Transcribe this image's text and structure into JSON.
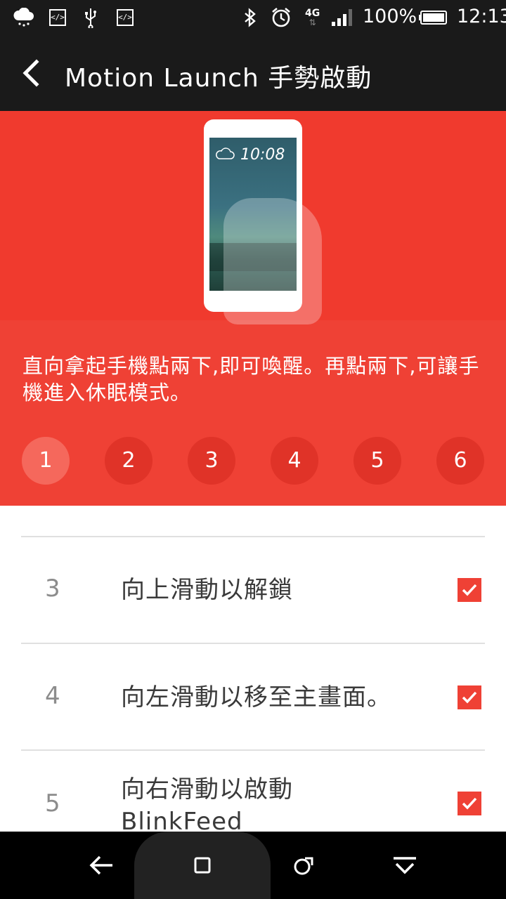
{
  "status_bar": {
    "battery_percent": "100%",
    "time": "12:13",
    "network_type": "4G",
    "icons": [
      "weather-cloud-rain-icon",
      "code-icon",
      "usb-icon",
      "code-icon",
      "bluetooth-icon",
      "alarm-icon",
      "signal-icon",
      "battery-icon"
    ]
  },
  "header": {
    "title": "Motion Launch 手勢啟動",
    "back_icon": "chevron-left-icon"
  },
  "hero": {
    "phone_time": "10:08",
    "description": "直向拿起手機點兩下,即可喚醒。再點兩下,可讓手機進入休眠模式。",
    "steps": [
      "1",
      "2",
      "3",
      "4",
      "5",
      "6"
    ],
    "active_step": "1",
    "accent_color": "#ef4135"
  },
  "list": {
    "items": [
      {
        "number": "3",
        "label": "向上滑動以解鎖",
        "checked": true
      },
      {
        "number": "4",
        "label": "向左滑動以移至主畫面。",
        "checked": true
      },
      {
        "number": "5",
        "label": "向右滑動以啟動 BlinkFeed",
        "checked": true
      }
    ]
  },
  "navbar": {
    "icons": [
      "back-icon",
      "home-icon",
      "recents-icon",
      "menu-down-icon"
    ]
  }
}
